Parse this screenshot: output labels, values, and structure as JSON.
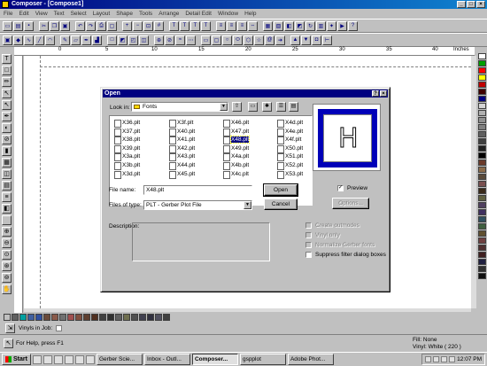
{
  "window": {
    "title": "Composer - [Compose1]"
  },
  "menu": [
    "File",
    "Edit",
    "View",
    "Text",
    "Select",
    "Layout",
    "Shape",
    "Tools",
    "Arrange",
    "Detail Edit",
    "Window",
    "Help"
  ],
  "ruler": {
    "marks": [
      "0",
      "5",
      "10",
      "15",
      "20",
      "25",
      "30",
      "35",
      "40"
    ],
    "unit": "Inches"
  },
  "dialog": {
    "title": "Open",
    "look_in_label": "Look in:",
    "look_in_value": "Fonts",
    "files": [
      [
        "X36.plt",
        "X37.plt",
        "X38.plt",
        "X39.plt",
        "X3a.plt",
        "X3b.plt",
        "X3d.plt"
      ],
      [
        "X3f.plt",
        "X40.plt",
        "X41.plt",
        "X42.plt",
        "X43.plt",
        "X44.plt",
        "X45.plt"
      ],
      [
        "X46.plt",
        "X47.plt",
        "X48.plt",
        "X49.plt",
        "X4a.plt",
        "X4b.plt",
        "X4c.plt"
      ],
      [
        "X4d.plt",
        "X4e.plt",
        "X4f.plt",
        "X50.plt",
        "X51.plt",
        "X52.plt",
        "X53.plt"
      ]
    ],
    "selected_file": "X48.plt",
    "preview_glyph": "H",
    "preview_label": "Preview",
    "options_label": "Options...",
    "file_name_label": "File name:",
    "file_name_value": "X48.plt",
    "files_of_type_label": "Files of type:",
    "files_of_type_value": "PLT - Gerber Plot File",
    "open_label": "Open",
    "cancel_label": "Cancel",
    "description_label": "Description:",
    "checks": [
      {
        "label": "Create outmodes",
        "enabled": false,
        "checked": false
      },
      {
        "label": "Vinyl only",
        "enabled": false,
        "checked": false
      },
      {
        "label": "Normalize Gerber fonts",
        "enabled": false,
        "checked": false
      },
      {
        "label": "Suppress filter dialog boxes",
        "enabled": true,
        "checked": false
      }
    ]
  },
  "vinyl": {
    "label": "Vinyls in Job:"
  },
  "status": {
    "help": "For Help, press F1",
    "fill": "Fill: None",
    "vinyl": "Vinyl: White ( 220 )"
  },
  "taskbar": {
    "start": "Start",
    "tasks": [
      "Gerber Scie...",
      "Inbox - Outl...",
      "Composer...",
      "gspplot",
      "Adobe Phot..."
    ],
    "active_task": 2,
    "clock": "12:07 PM"
  },
  "colors": {
    "title_bar": "#000080",
    "palette_right": [
      "#ffffff",
      "#00a000",
      "#ff0000",
      "#ffff00",
      "#c00000",
      "#400000",
      "#000080",
      "#d4d4d4",
      "#b0b0b0",
      "#909090",
      "#808080",
      "#606060",
      "#404040",
      "#202020",
      "#000000",
      "#6b3a2a",
      "#8b6b4a",
      "#5a4a3a",
      "#7a5050",
      "#3a2a1a",
      "#606040",
      "#504060",
      "#403060",
      "#305060",
      "#406040",
      "#605030",
      "#704040",
      "#503030",
      "#402020",
      "#202040",
      "#303030",
      "#101010"
    ],
    "palette_bottom": [
      "#c0c0c0",
      "#606060",
      "#00a0a0",
      "#4060a0",
      "#3050a0",
      "#6a4a3a",
      "#8a5a4a",
      "#707070",
      "#a05050",
      "#805040",
      "#604030",
      "#503020",
      "#404040",
      "#303030",
      "#606060",
      "#707050",
      "#505050",
      "#404050",
      "#303040",
      "#505060",
      "#404040"
    ]
  }
}
